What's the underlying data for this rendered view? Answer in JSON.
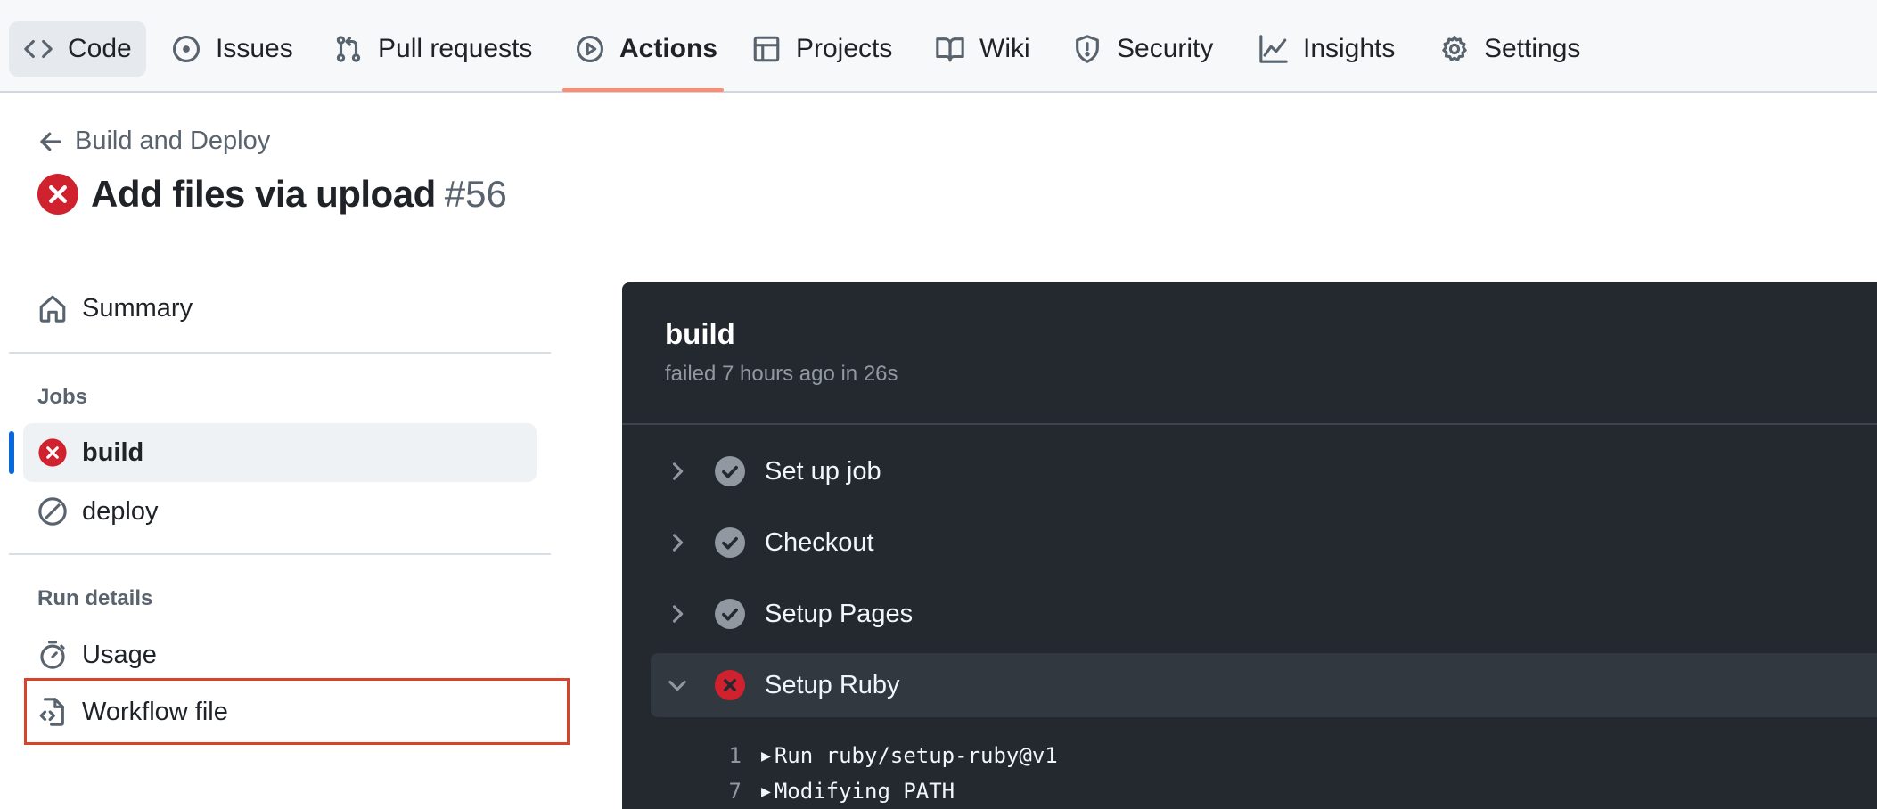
{
  "repo_nav": {
    "tabs": [
      {
        "label": "Code",
        "icon": "code-icon"
      },
      {
        "label": "Issues",
        "icon": "issue-icon"
      },
      {
        "label": "Pull requests",
        "icon": "pull-request-icon"
      },
      {
        "label": "Actions",
        "icon": "play-icon",
        "active": true
      },
      {
        "label": "Projects",
        "icon": "table-icon"
      },
      {
        "label": "Wiki",
        "icon": "book-icon"
      },
      {
        "label": "Security",
        "icon": "shield-icon"
      },
      {
        "label": "Insights",
        "icon": "graph-icon"
      },
      {
        "label": "Settings",
        "icon": "gear-icon"
      }
    ]
  },
  "header": {
    "back_label": "Build and Deploy",
    "run_title": "Add files via upload",
    "run_number": "#56",
    "status": "failed"
  },
  "sidebar": {
    "summary_label": "Summary",
    "jobs_heading": "Jobs",
    "jobs": [
      {
        "label": "build",
        "status": "failed",
        "selected": true
      },
      {
        "label": "deploy",
        "status": "skipped",
        "selected": false
      }
    ],
    "run_details_heading": "Run details",
    "usage_label": "Usage",
    "workflow_file_label": "Workflow file"
  },
  "log": {
    "job_name": "build",
    "job_meta": "failed 7 hours ago in 26s",
    "steps": [
      {
        "label": "Set up job",
        "status": "success",
        "expanded": false
      },
      {
        "label": "Checkout",
        "status": "success",
        "expanded": false
      },
      {
        "label": "Setup Pages",
        "status": "success",
        "expanded": false
      },
      {
        "label": "Setup Ruby",
        "status": "failed",
        "expanded": true
      }
    ],
    "lines": [
      {
        "num": "1",
        "text": "Run ruby/setup-ruby@v1"
      },
      {
        "num": "7",
        "text": "Modifying PATH"
      }
    ]
  },
  "colors": {
    "fail_red": "#cf222e",
    "accent_blue": "#0969da",
    "active_tab_underline": "#fd8c73",
    "log_bg": "#24292f",
    "highlight_box": "#d9432a"
  }
}
